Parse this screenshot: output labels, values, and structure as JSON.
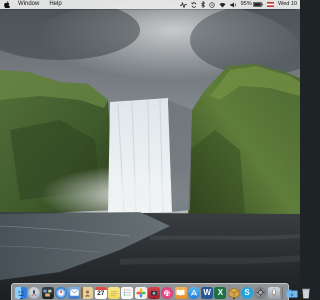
{
  "menubar": {
    "apple_icon": "apple-icon",
    "items": [
      "Window",
      "Help"
    ],
    "status_icons": [
      "activity-icon",
      "sync-icon",
      "bluetooth-icon",
      "timemachine-icon",
      "wifi-icon",
      "volume-icon"
    ],
    "battery_percent": "95%",
    "clock": "Wed 10"
  },
  "desktop": {
    "wallpaper": "waterfall-landscape"
  },
  "dock": {
    "apps": [
      {
        "name": "finder",
        "icon": "finder-icon",
        "color": "#3a8fe6"
      },
      {
        "name": "launchpad",
        "icon": "launchpad-icon",
        "color": "#9aa6b4"
      },
      {
        "name": "mission-control",
        "icon": "mission-control-icon",
        "color": "#2b2f3a"
      },
      {
        "name": "safari",
        "icon": "safari-icon",
        "color": "#2f86dd"
      },
      {
        "name": "mail",
        "icon": "mail-icon",
        "color": "#4c8fd8"
      },
      {
        "name": "contacts",
        "icon": "contacts-icon",
        "color": "#c9a46a"
      },
      {
        "name": "calendar",
        "icon": "calendar-icon",
        "color": "#ffffff"
      },
      {
        "name": "notes",
        "icon": "notes-icon",
        "color": "#f4e27a"
      },
      {
        "name": "reminders",
        "icon": "reminders-icon",
        "color": "#f6f6f6"
      },
      {
        "name": "photos",
        "icon": "photos-icon",
        "color": "#e9e0d8"
      },
      {
        "name": "photo-booth",
        "icon": "photo-booth-icon",
        "color": "#c8313a"
      },
      {
        "name": "itunes",
        "icon": "itunes-icon",
        "color": "#e94e8a"
      },
      {
        "name": "ibooks",
        "icon": "ibooks-icon",
        "color": "#f2a13a"
      },
      {
        "name": "app-store",
        "icon": "app-store-icon",
        "color": "#2a9be6"
      },
      {
        "name": "word",
        "icon": "word-icon",
        "color": "#2b5797"
      },
      {
        "name": "excel",
        "icon": "excel-icon",
        "color": "#1e7145"
      },
      {
        "name": "virtualbox",
        "icon": "virtualbox-icon",
        "color": "#d6a64a"
      },
      {
        "name": "skype",
        "icon": "skype-icon",
        "color": "#20a3e0"
      },
      {
        "name": "system-preferences",
        "icon": "gear-icon",
        "color": "#8c8f94"
      },
      {
        "name": "launcher",
        "icon": "rocket-icon",
        "color": "#b7bdc6"
      }
    ],
    "trailing": [
      {
        "name": "downloads-folder",
        "icon": "folder-icon",
        "color": "#5aa6e8"
      },
      {
        "name": "trash",
        "icon": "trash-icon",
        "color": "#d9dde2"
      }
    ],
    "glyphs": {
      "calendar_day": "27",
      "word": "W",
      "excel": "X",
      "skype": "S"
    }
  }
}
